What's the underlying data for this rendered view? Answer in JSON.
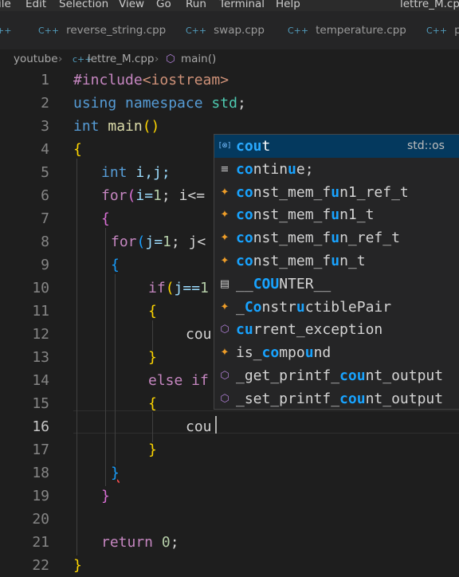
{
  "menu": {
    "items": [
      "ile",
      "Edit",
      "Selection",
      "View",
      "Go",
      "Run",
      "Terminal",
      "Help"
    ],
    "window_title": "lettre_M.cpp"
  },
  "tabs": [
    {
      "label": "reverse_string.cpp",
      "icon": "C++"
    },
    {
      "label": "swap.cpp",
      "icon": "C++"
    },
    {
      "label": "temperature.cpp",
      "icon": "C++"
    },
    {
      "label": "prin",
      "icon": "C++"
    }
  ],
  "tab_prefix_icon": "c++",
  "breadcrumb": {
    "folder": "youtube",
    "file": "lettre_M.cpp",
    "symbol": "main()"
  },
  "line_numbers": [
    "1",
    "2",
    "3",
    "4",
    "5",
    "6",
    "7",
    "8",
    "9",
    "10",
    "11",
    "12",
    "13",
    "14",
    "15",
    "16",
    "17",
    "18",
    "19",
    "20",
    "21",
    "22"
  ],
  "active_line": 16,
  "code": {
    "l1_directive": "#include",
    "l1_header": "<iostream>",
    "l2_using": "using",
    "l2_namespace": "namespace",
    "l2_std": "std",
    "l2_semi": ";",
    "l3_type": "int",
    "l3_name": "main",
    "l3_parens": "()",
    "l4": "{",
    "l5_type": "int",
    "l5_rest": " i,j;",
    "l6_kw": "for",
    "l6_paren": "(",
    "l6_rest": "i=",
    "l6_num": "1",
    "l6_tail": "; i<=",
    "l7": "{",
    "l8_kw": "for",
    "l8_paren": "(",
    "l8_rest": "j=",
    "l8_num": "1",
    "l8_tail": "; j<",
    "l9": "{",
    "l10_kw": "if",
    "l10_paren": "(",
    "l10_rest": "j==",
    "l10_num": "1",
    "l11": "{",
    "l12": "cou",
    "l13": "}",
    "l14_kw": "else if",
    "l15": "{",
    "l16": "cou",
    "l17": "}",
    "l18": "}",
    "l19": "}",
    "l21_kw": "return",
    "l21_num": "0",
    "l21_semi": ";",
    "l22": "}"
  },
  "suggestions": [
    {
      "icon": "[⊗]",
      "before": "",
      "match": "cou",
      "after": "t",
      "mid": "",
      "detail": "std::os",
      "selected": true
    },
    {
      "icon": "≡",
      "before": "",
      "match": "co",
      "after": "ntin",
      "mid": "u",
      "tail": "e;",
      "selected": false
    },
    {
      "icon": "✦",
      "before": "",
      "match": "co",
      "after": "nst_mem_f",
      "mid": "u",
      "tail": "n1_ref_t",
      "selected": false
    },
    {
      "icon": "✦",
      "before": "",
      "match": "co",
      "after": "nst_mem_f",
      "mid": "u",
      "tail": "n1_t",
      "selected": false
    },
    {
      "icon": "✦",
      "before": "",
      "match": "co",
      "after": "nst_mem_f",
      "mid": "u",
      "tail": "n_ref_t",
      "selected": false
    },
    {
      "icon": "✦",
      "before": "",
      "match": "co",
      "after": "nst_mem_f",
      "mid": "u",
      "tail": "n_t",
      "selected": false
    },
    {
      "icon": "▤",
      "before": "__",
      "match": "CO",
      "after": "",
      "mid": "U",
      "tail": "NTER__",
      "selected": false
    },
    {
      "icon": "✦",
      "before": "_",
      "match": "Co",
      "after": "nstr",
      "mid": "u",
      "tail": "ctiblePair",
      "selected": false
    },
    {
      "icon": "⬡",
      "before": "",
      "match": "cu",
      "after": "rrent_exception",
      "mid": "",
      "tail": "",
      "selected": false
    },
    {
      "icon": "✦",
      "before": "is_",
      "match": "co",
      "after": "mpo",
      "mid": "u",
      "tail": "nd",
      "selected": false
    },
    {
      "icon": "⬡",
      "before": "_get_printf_",
      "match": "cou",
      "after": "nt_output",
      "mid": "",
      "tail": "",
      "selected": false
    },
    {
      "icon": "⬡",
      "before": "_set_printf_",
      "match": "cou",
      "after": "nt_output",
      "mid": "",
      "tail": "",
      "selected": false
    }
  ],
  "colors": {
    "editor_bg": "#1e1e1e",
    "keyword": "#569cd6",
    "preprocessor": "#c586c0",
    "string": "#ce9178",
    "function": "#dcdcaa",
    "number": "#b5cea8",
    "match_highlight": "#18a3ff",
    "selection_bg": "#04395e"
  }
}
